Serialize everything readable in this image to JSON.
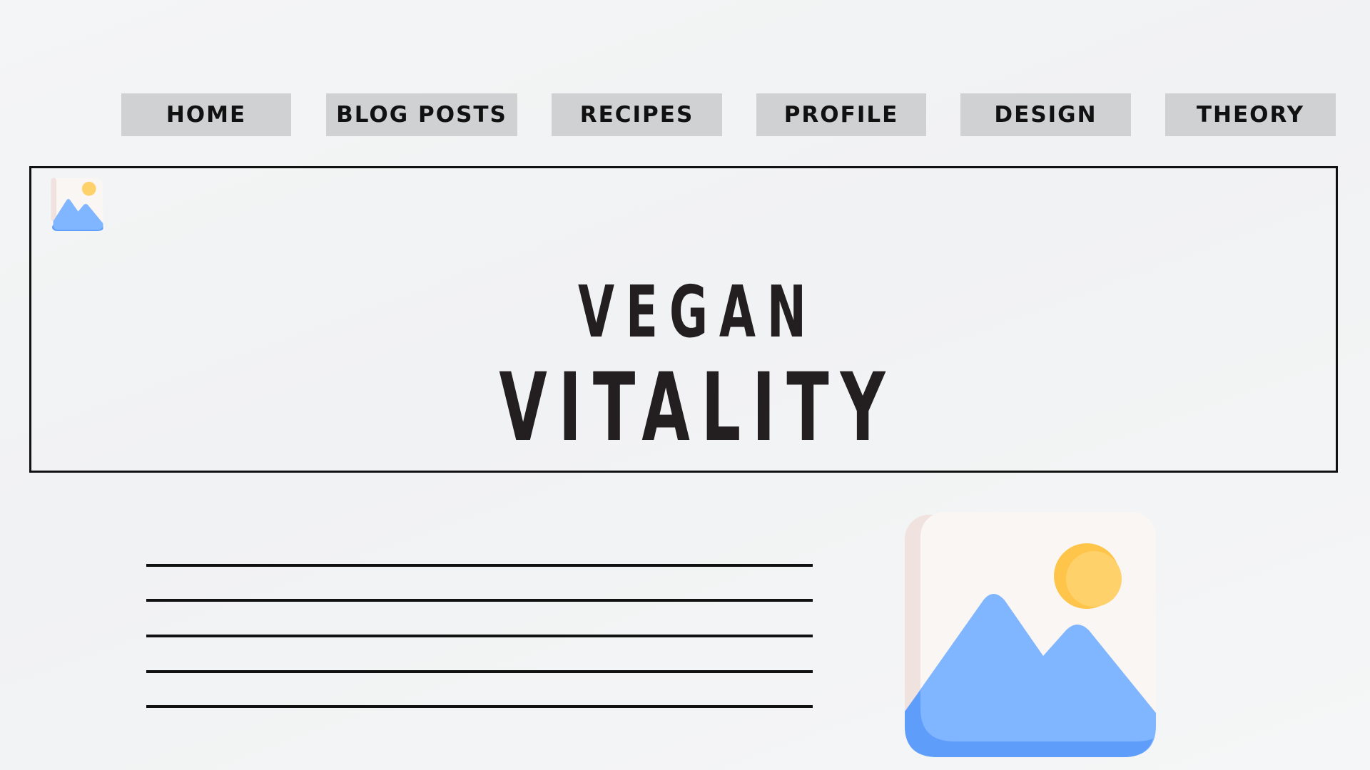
{
  "nav": {
    "items": [
      {
        "label": "HOME"
      },
      {
        "label": "BLOG POSTS"
      },
      {
        "label": "RECIPES"
      },
      {
        "label": "PROFILE"
      },
      {
        "label": "DESIGN"
      },
      {
        "label": "THEORY"
      }
    ]
  },
  "hero": {
    "title_line1": "VEGAN",
    "title_line2": "VITALITY",
    "logo_icon": "image-placeholder-icon"
  },
  "content": {
    "text_lines_count_visible": 5,
    "image_icon": "image-placeholder-icon"
  },
  "colors": {
    "background": "#f3f4f5",
    "nav_button": "#d0d1d3",
    "text": "#111111",
    "image_blue": "#80b5ff",
    "image_sun": "#ffd16b",
    "image_frame": "#f9f6f4"
  }
}
